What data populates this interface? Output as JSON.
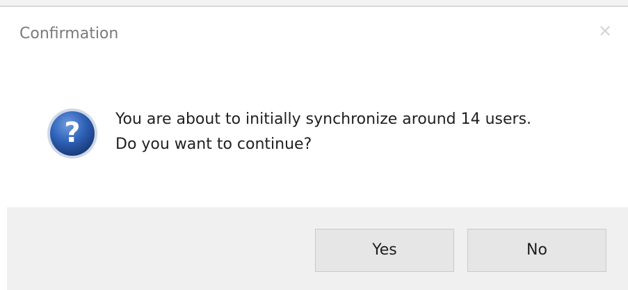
{
  "dialog": {
    "title": "Confirmation",
    "close_icon": "close-icon",
    "icon": "question-icon",
    "message_line1": "You are about to initially synchronize around 14 users.",
    "message_line2": "Do you want to continue?",
    "buttons": {
      "yes": "Yes",
      "no": "No"
    }
  },
  "colors": {
    "footer_bg": "#f0f0f0",
    "icon_blue": "#2a5db0",
    "title_text": "#7a7a7a"
  }
}
